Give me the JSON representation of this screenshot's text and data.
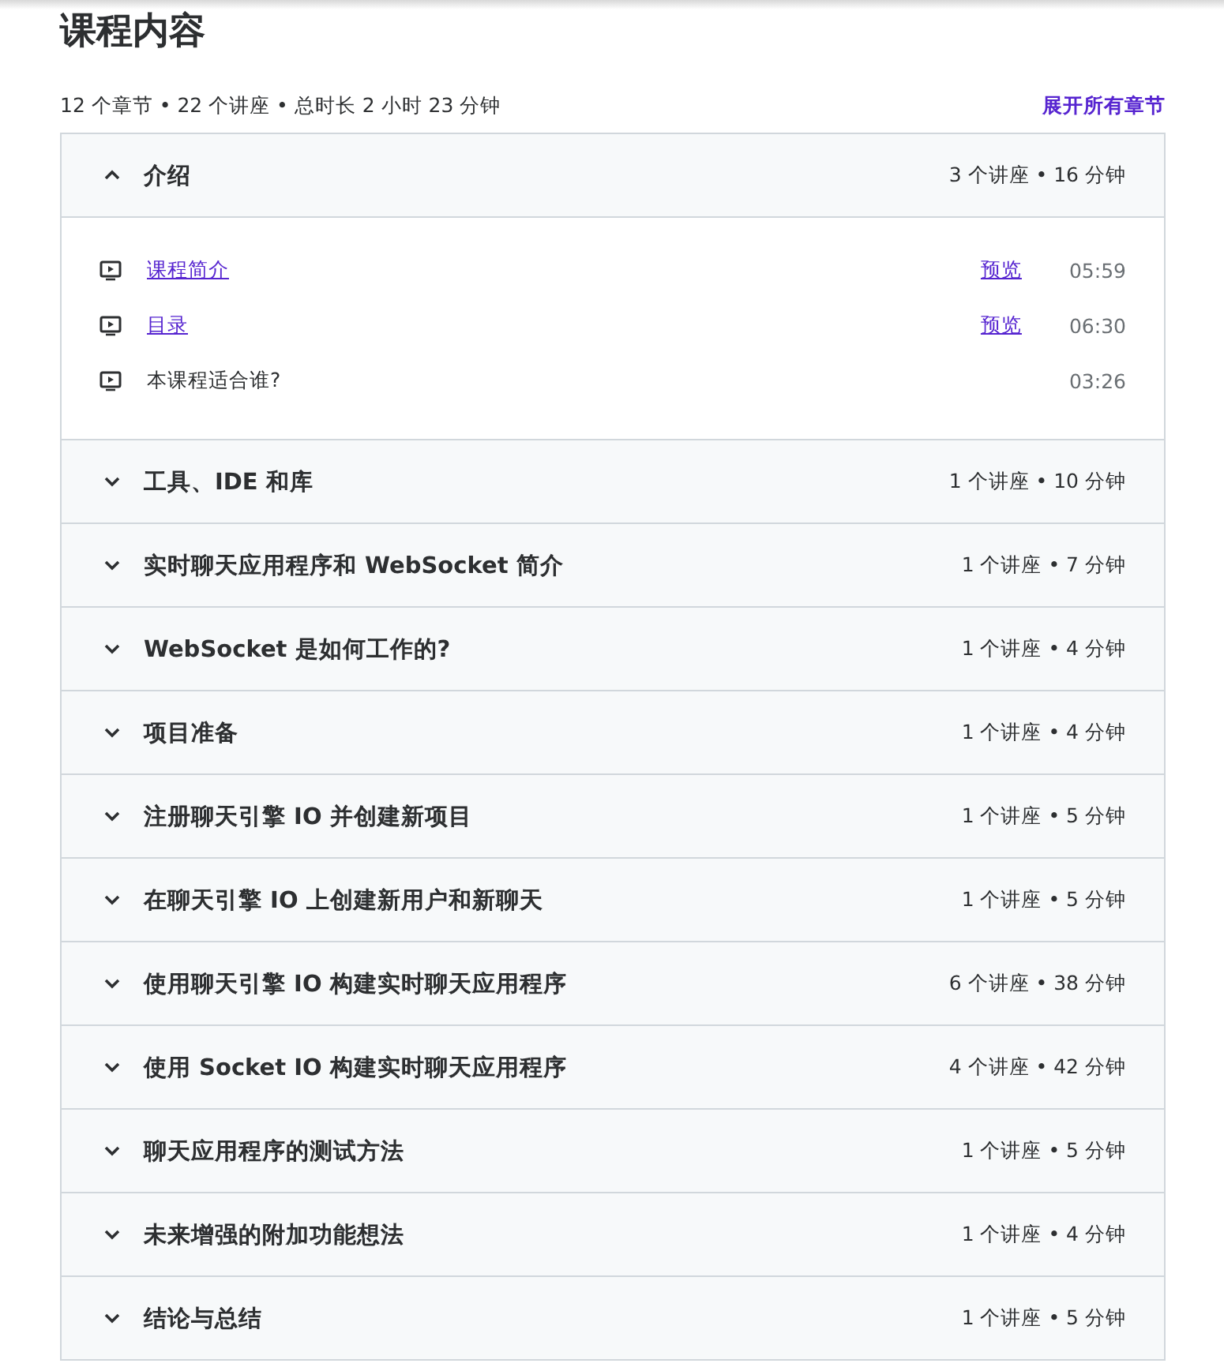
{
  "title": "课程内容",
  "summary": "12 个章节 • 22 个讲座 • 总时长 2 小时 23 分钟",
  "expand_all": "展开所有章节",
  "sections": [
    {
      "title": "介绍",
      "meta": "3 个讲座 • 16 分钟",
      "expanded": true,
      "lectures": [
        {
          "title": "课程简介",
          "link": true,
          "preview": "预览",
          "duration": "05:59"
        },
        {
          "title": "目录",
          "link": true,
          "preview": "预览",
          "duration": "06:30"
        },
        {
          "title": "本课程适合谁?",
          "link": false,
          "duration": "03:26"
        }
      ]
    },
    {
      "title": "工具、IDE 和库",
      "meta": "1 个讲座 • 10 分钟",
      "expanded": false
    },
    {
      "title": "实时聊天应用程序和 WebSocket 简介",
      "meta": "1 个讲座 • 7 分钟",
      "expanded": false
    },
    {
      "title": "WebSocket 是如何工作的?",
      "meta": "1 个讲座 • 4 分钟",
      "expanded": false
    },
    {
      "title": "项目准备",
      "meta": "1 个讲座 • 4 分钟",
      "expanded": false
    },
    {
      "title": "注册聊天引擎 IO 并创建新项目",
      "meta": "1 个讲座 • 5 分钟",
      "expanded": false
    },
    {
      "title": "在聊天引擎 IO 上创建新用户和新聊天",
      "meta": "1 个讲座 • 5 分钟",
      "expanded": false
    },
    {
      "title": "使用聊天引擎 IO 构建实时聊天应用程序",
      "meta": "6 个讲座 • 38 分钟",
      "expanded": false
    },
    {
      "title": "使用 Socket IO 构建实时聊天应用程序",
      "meta": "4 个讲座 • 42 分钟",
      "expanded": false
    },
    {
      "title": "聊天应用程序的测试方法",
      "meta": "1 个讲座 • 5 分钟",
      "expanded": false
    },
    {
      "title": "未来增强的附加功能想法",
      "meta": "1 个讲座 • 4 分钟",
      "expanded": false
    },
    {
      "title": "结论与总结",
      "meta": "1 个讲座 • 5 分钟",
      "expanded": false
    }
  ]
}
